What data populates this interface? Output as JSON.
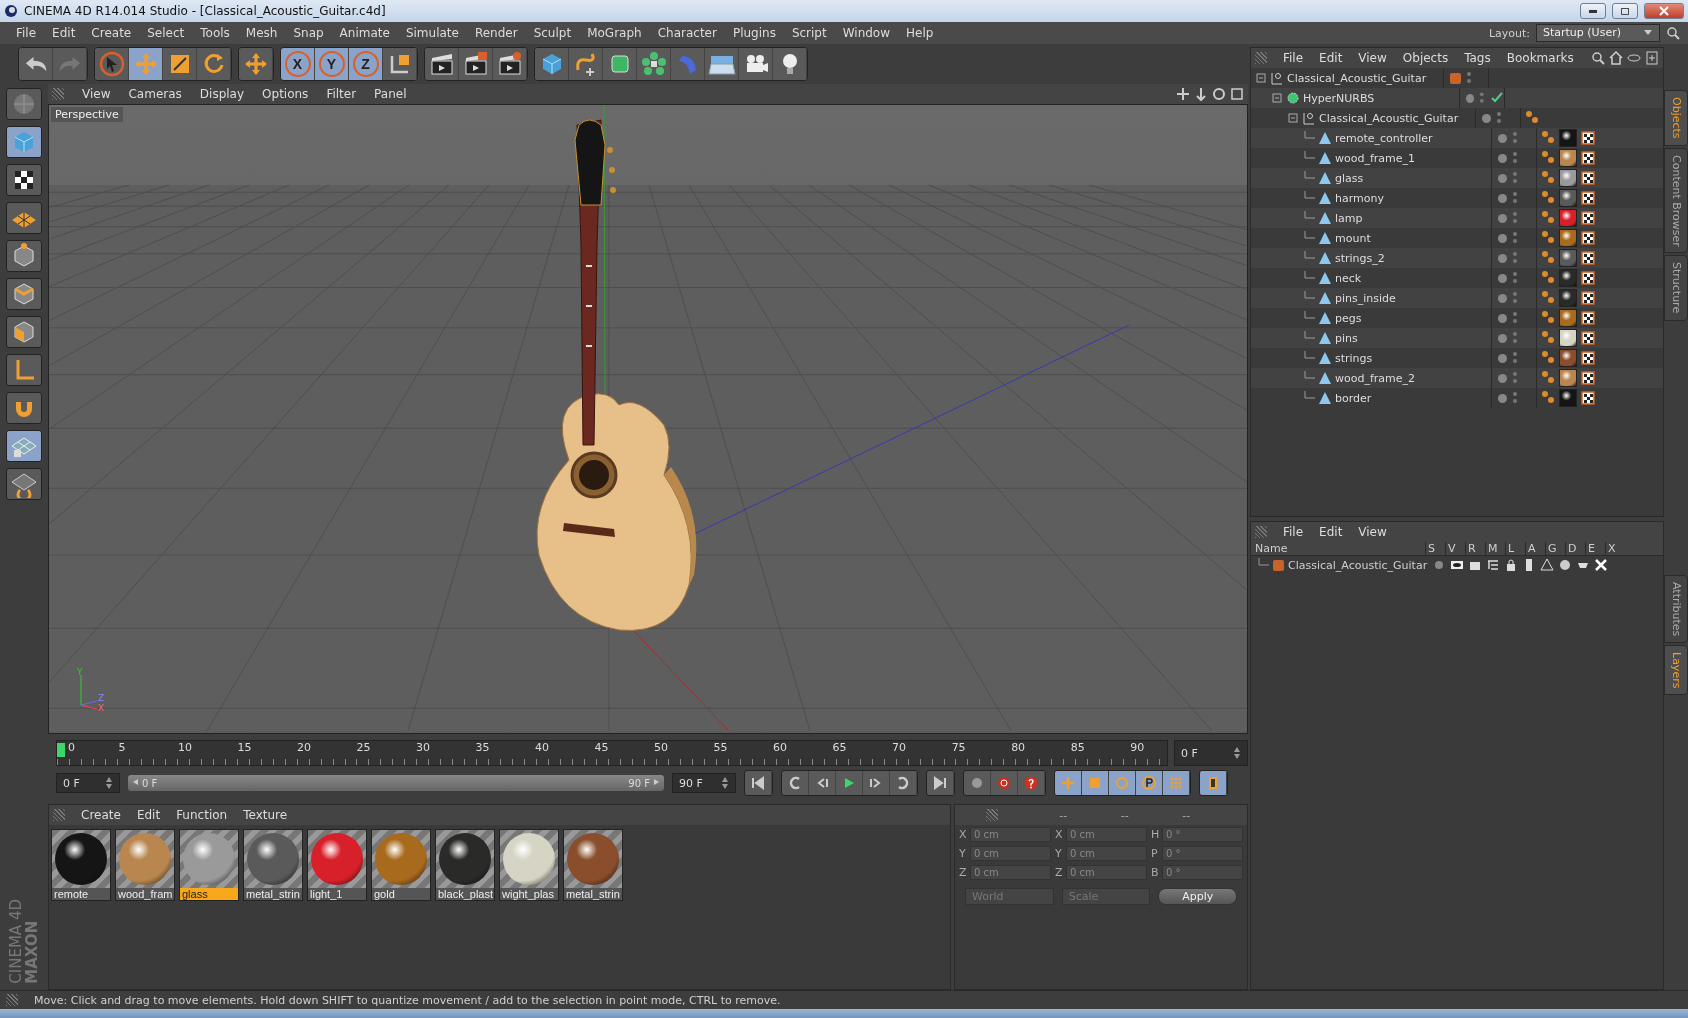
{
  "window": {
    "title": "CINEMA 4D R14.014 Studio - [Classical_Acoustic_Guitar.c4d]"
  },
  "menu": [
    "File",
    "Edit",
    "Create",
    "Select",
    "Tools",
    "Mesh",
    "Snap",
    "Animate",
    "Simulate",
    "Render",
    "Sculpt",
    "MoGraph",
    "Character",
    "Plugins",
    "Script",
    "Window",
    "Help"
  ],
  "layout": {
    "label": "Layout:",
    "value": "Startup (User)"
  },
  "toolbar": [
    [
      {
        "kind": "undo",
        "selected": false
      },
      {
        "kind": "redo",
        "selected": false
      }
    ],
    [
      {
        "kind": "pointer",
        "selected": false
      },
      {
        "kind": "move",
        "selected": true
      },
      {
        "kind": "scale",
        "selected": false
      },
      {
        "kind": "rotate",
        "selected": false
      }
    ],
    [
      {
        "kind": "cross",
        "selected": false
      }
    ],
    [
      {
        "kind": "axis-letter",
        "label": "X",
        "selected": true
      },
      {
        "kind": "axis-letter",
        "label": "Y",
        "selected": true
      },
      {
        "kind": "axis-letter",
        "label": "Z",
        "selected": true
      },
      {
        "kind": "coords",
        "selected": false
      }
    ],
    [
      {
        "kind": "render-view",
        "selected": false
      },
      {
        "kind": "render",
        "selected": false
      },
      {
        "kind": "render-settings",
        "selected": false
      }
    ],
    [
      {
        "kind": "cube",
        "selected": false
      },
      {
        "kind": "spline",
        "selected": false
      },
      {
        "kind": "nurbs",
        "selected": false
      },
      {
        "kind": "array",
        "selected": false
      },
      {
        "kind": "deformer",
        "selected": false
      },
      {
        "kind": "floor",
        "selected": false
      },
      {
        "kind": "camera",
        "selected": false
      },
      {
        "kind": "light",
        "selected": false
      }
    ]
  ],
  "left_tools": [
    {
      "kind": "view",
      "selected": false
    },
    {
      "kind": "cube",
      "selected": true
    },
    {
      "kind": "checker",
      "selected": false
    },
    {
      "kind": "plane",
      "selected": false
    },
    {
      "kind": "points",
      "selected": false
    },
    {
      "kind": "edges",
      "selected": false
    },
    {
      "kind": "polygons",
      "selected": false
    },
    {
      "kind": "corner",
      "selected": false
    },
    {
      "kind": "magnet",
      "selected": false
    },
    {
      "kind": "grid",
      "selected": true
    },
    {
      "kind": "snap",
      "selected": false
    }
  ],
  "brand": {
    "maker": "MAXON",
    "product": "CINEMA 4D"
  },
  "viewport": {
    "menu": [
      "View",
      "Cameras",
      "Display",
      "Options",
      "Filter",
      "Panel"
    ],
    "label": "Perspective",
    "gizmo": [
      "Y",
      "Z",
      "X"
    ]
  },
  "timeline": {
    "ticks": [
      "0",
      "5",
      "10",
      "15",
      "20",
      "25",
      "30",
      "35",
      "40",
      "45",
      "50",
      "55",
      "60",
      "65",
      "70",
      "75",
      "80",
      "85",
      "90"
    ],
    "playhead": {
      "level": 0
    },
    "frame": "0 F"
  },
  "transport": {
    "level": 1,
    "start": "0 F",
    "range_start": "0 F",
    "range_end": "90 F",
    "end": "90 F"
  },
  "materials": {
    "menu": [
      "Create",
      "Edit",
      "Function",
      "Texture"
    ],
    "items": [
      {
        "name": "remote",
        "color": "#151515",
        "selected": false
      },
      {
        "name": "wood_fram",
        "color": "#b8864e",
        "selected": false
      },
      {
        "name": "glass",
        "color": "#9a9a9a",
        "selected": true
      },
      {
        "name": "metal_strin",
        "color": "#5a5a5a",
        "selected": false
      },
      {
        "name": "light_1",
        "color": "#d8202a",
        "selected": false
      },
      {
        "name": "gold",
        "color": "#a86a1c",
        "selected": false
      },
      {
        "name": "black_plast",
        "color": "#2a2a28",
        "selected": false
      },
      {
        "name": "wight_plas",
        "color": "#d6d4c4",
        "selected": false
      },
      {
        "name": "metal_strin",
        "color": "#8a4e2c",
        "selected": false
      }
    ]
  },
  "coordinates": {
    "headers": [
      "--",
      "--",
      "--"
    ],
    "rows": [
      [
        {
          "axis": "X",
          "value": "0 cm"
        },
        {
          "axis": "X",
          "value": "0 cm"
        },
        {
          "axis": "H",
          "value": "0 °"
        }
      ],
      [
        {
          "axis": "Y",
          "value": "0 cm"
        },
        {
          "axis": "Y",
          "value": "0 cm"
        },
        {
          "axis": "P",
          "value": "0 °"
        }
      ],
      [
        {
          "axis": "Z",
          "value": "0 cm"
        },
        {
          "axis": "Z",
          "value": "0 cm"
        },
        {
          "axis": "B",
          "value": "0 °"
        }
      ]
    ],
    "space": "World",
    "mode": "Scale",
    "apply": "Apply"
  },
  "objects": {
    "menu": [
      "File",
      "Edit",
      "View",
      "Objects",
      "Tags",
      "Bookmarks"
    ],
    "tree": [
      {
        "name": "Classical_Acoustic_Guitar",
        "kind": "null",
        "color": "#c8642a",
        "checked": false,
        "phong": false,
        "children": [
          {
            "name": "HyperNURBS",
            "kind": "nurbs",
            "checked": true,
            "phong": false,
            "children": [
              {
                "name": "Classical_Acoustic_Guitar",
                "kind": "null",
                "checked": false,
                "phong": true,
                "children": [
                  {
                    "name": "remote_controller",
                    "kind": "polygon",
                    "checked": false,
                    "phong": true,
                    "color": "#151515"
                  },
                  {
                    "name": "wood_frame_1",
                    "kind": "polygon",
                    "checked": false,
                    "phong": true,
                    "color": "#b8864e"
                  },
                  {
                    "name": "glass",
                    "kind": "polygon",
                    "checked": false,
                    "phong": true,
                    "color": "#9a9a9a"
                  },
                  {
                    "name": "harmony",
                    "kind": "polygon",
                    "checked": false,
                    "phong": true,
                    "color": "#5a5a5a"
                  },
                  {
                    "name": "lamp",
                    "kind": "polygon",
                    "checked": false,
                    "phong": true,
                    "color": "#d8202a"
                  },
                  {
                    "name": "mount",
                    "kind": "polygon",
                    "checked": false,
                    "phong": true,
                    "color": "#a86a1c"
                  },
                  {
                    "name": "strings_2",
                    "kind": "polygon",
                    "checked": false,
                    "phong": true,
                    "color": "#5a5a5a"
                  },
                  {
                    "name": "neck",
                    "kind": "polygon",
                    "checked": false,
                    "phong": true,
                    "color": "#2a2a28"
                  },
                  {
                    "name": "pins_inside",
                    "kind": "polygon",
                    "checked": false,
                    "phong": true,
                    "color": "#2a2a28"
                  },
                  {
                    "name": "pegs",
                    "kind": "polygon",
                    "checked": false,
                    "phong": true,
                    "color": "#a86a1c"
                  },
                  {
                    "name": "pins",
                    "kind": "polygon",
                    "checked": false,
                    "phong": true,
                    "color": "#d6d4c4"
                  },
                  {
                    "name": "strings",
                    "kind": "polygon",
                    "checked": false,
                    "phong": true,
                    "color": "#8a4e2c"
                  },
                  {
                    "name": "wood_frame_2",
                    "kind": "polygon",
                    "checked": false,
                    "phong": true,
                    "color": "#b8864e"
                  },
                  {
                    "name": "border",
                    "kind": "polygon",
                    "checked": false,
                    "phong": true,
                    "color": "#151515"
                  }
                ]
              }
            ]
          }
        ]
      }
    ]
  },
  "layers": {
    "menu": [
      "File",
      "Edit",
      "View"
    ],
    "columns": [
      "Name",
      "S",
      "V",
      "R",
      "M",
      "L",
      "A",
      "G",
      "D",
      "E",
      "X"
    ],
    "rows": [
      {
        "name": "Classical_Acoustic_Guitar",
        "color": "#c8642a"
      }
    ]
  },
  "side_tabs_top": [
    {
      "label": "Objects",
      "selected": true
    },
    {
      "label": "Content Browser",
      "selected": false
    },
    {
      "label": "Structure",
      "selected": false
    }
  ],
  "side_tabs_bottom": [
    {
      "label": "Attributes",
      "selected": false
    },
    {
      "label": "Layers",
      "selected": true
    }
  ],
  "status_bar": "Move: Click and drag to move elements. Hold down SHIFT to quantize movement / add to the selection in point mode, CTRL to remove."
}
